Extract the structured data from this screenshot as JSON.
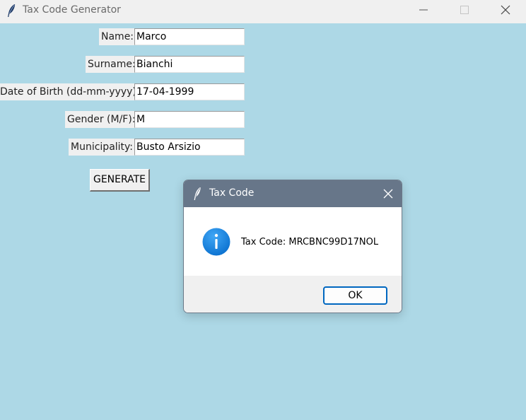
{
  "window": {
    "title": "Tax Code Generator",
    "icons": [
      "feather-icon",
      "minimize-icon",
      "maximize-icon",
      "close-icon"
    ]
  },
  "form": {
    "name_label": "Name:",
    "name_value": "Marco",
    "surname_label": "Surname:",
    "surname_value": "Bianchi",
    "dob_label": "Date of Birth (dd-mm-yyyy):",
    "dob_value": "17-04-1999",
    "gender_label": "Gender (M/F):",
    "gender_value": "M",
    "municipality_label": "Municipality:",
    "municipality_value": "Busto Arsizio",
    "generate_label": "GENERATE"
  },
  "dialog": {
    "title": "Tax Code",
    "message": "Tax Code: MRCBNC99D17NOL",
    "ok_label": "OK",
    "icons": [
      "feather-icon",
      "close-icon",
      "info-icon"
    ]
  },
  "colors": {
    "window_background": "#add8e6",
    "titlebar": "#f0f0f0",
    "dialog_titlebar": "#677689",
    "ok_border": "#0067c0",
    "info_icon": "#1a8ae5"
  }
}
